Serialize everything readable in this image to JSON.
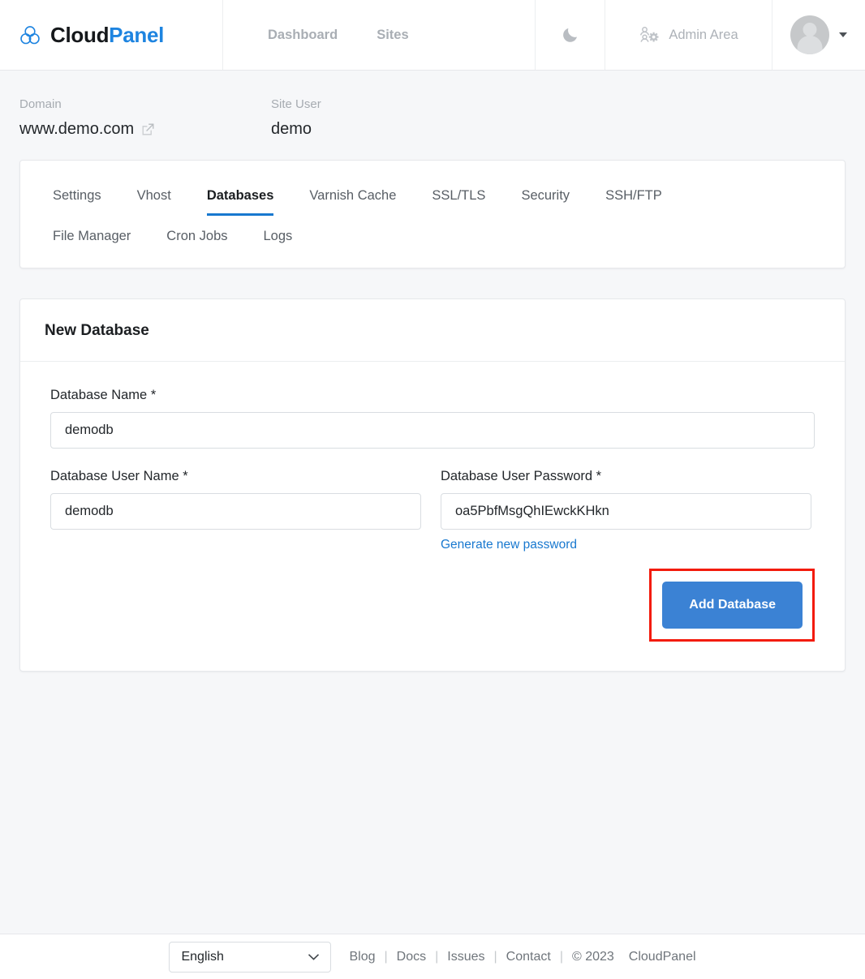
{
  "header": {
    "brand": {
      "first": "Cloud",
      "second": "Panel"
    },
    "nav": [
      {
        "label": "Dashboard",
        "name": "nav-dashboard"
      },
      {
        "label": "Sites",
        "name": "nav-sites"
      }
    ],
    "dark_mode_icon": "moon-icon",
    "admin": {
      "label": "Admin Area",
      "icon": "users-gear-icon"
    },
    "avatar": {
      "icon": "avatar-icon",
      "caret": "caret-down-icon"
    }
  },
  "meta": {
    "domain_label": "Domain",
    "domain_value": "www.demo.com",
    "domain_link_icon": "external-link-icon",
    "site_user_label": "Site User",
    "site_user_value": "demo"
  },
  "tabs": {
    "row1": [
      {
        "label": "Settings",
        "active": false
      },
      {
        "label": "Vhost",
        "active": false
      },
      {
        "label": "Databases",
        "active": true
      },
      {
        "label": "Varnish Cache",
        "active": false
      },
      {
        "label": "SSL/TLS",
        "active": false
      },
      {
        "label": "Security",
        "active": false
      },
      {
        "label": "SSH/FTP",
        "active": false
      }
    ],
    "row2": [
      {
        "label": "File Manager",
        "active": false
      },
      {
        "label": "Cron Jobs",
        "active": false
      },
      {
        "label": "Logs",
        "active": false
      }
    ],
    "active_indicator_color": "#1878cf"
  },
  "form": {
    "card_title": "New Database",
    "database_name": {
      "label": "Database Name *",
      "value": "demodb",
      "placeholder": ""
    },
    "database_user_name": {
      "label": "Database User Name *",
      "value": "demodb",
      "placeholder": ""
    },
    "database_user_password": {
      "label": "Database User Password *",
      "value": "oa5PbfMsgQhIEwckKHkn",
      "placeholder": ""
    },
    "generate_password_link": "Generate new password",
    "submit_label": "Add Database",
    "submit_color": "#3b82d4",
    "highlight_color": "#f31b0c"
  },
  "footer": {
    "language_selected": "English",
    "language_options": [
      "English"
    ],
    "links": [
      {
        "label": "Blog"
      },
      {
        "label": "Docs"
      },
      {
        "label": "Issues"
      },
      {
        "label": "Contact"
      }
    ],
    "separator": "|",
    "copyright": "© 2023",
    "copyright_brand": "CloudPanel"
  }
}
